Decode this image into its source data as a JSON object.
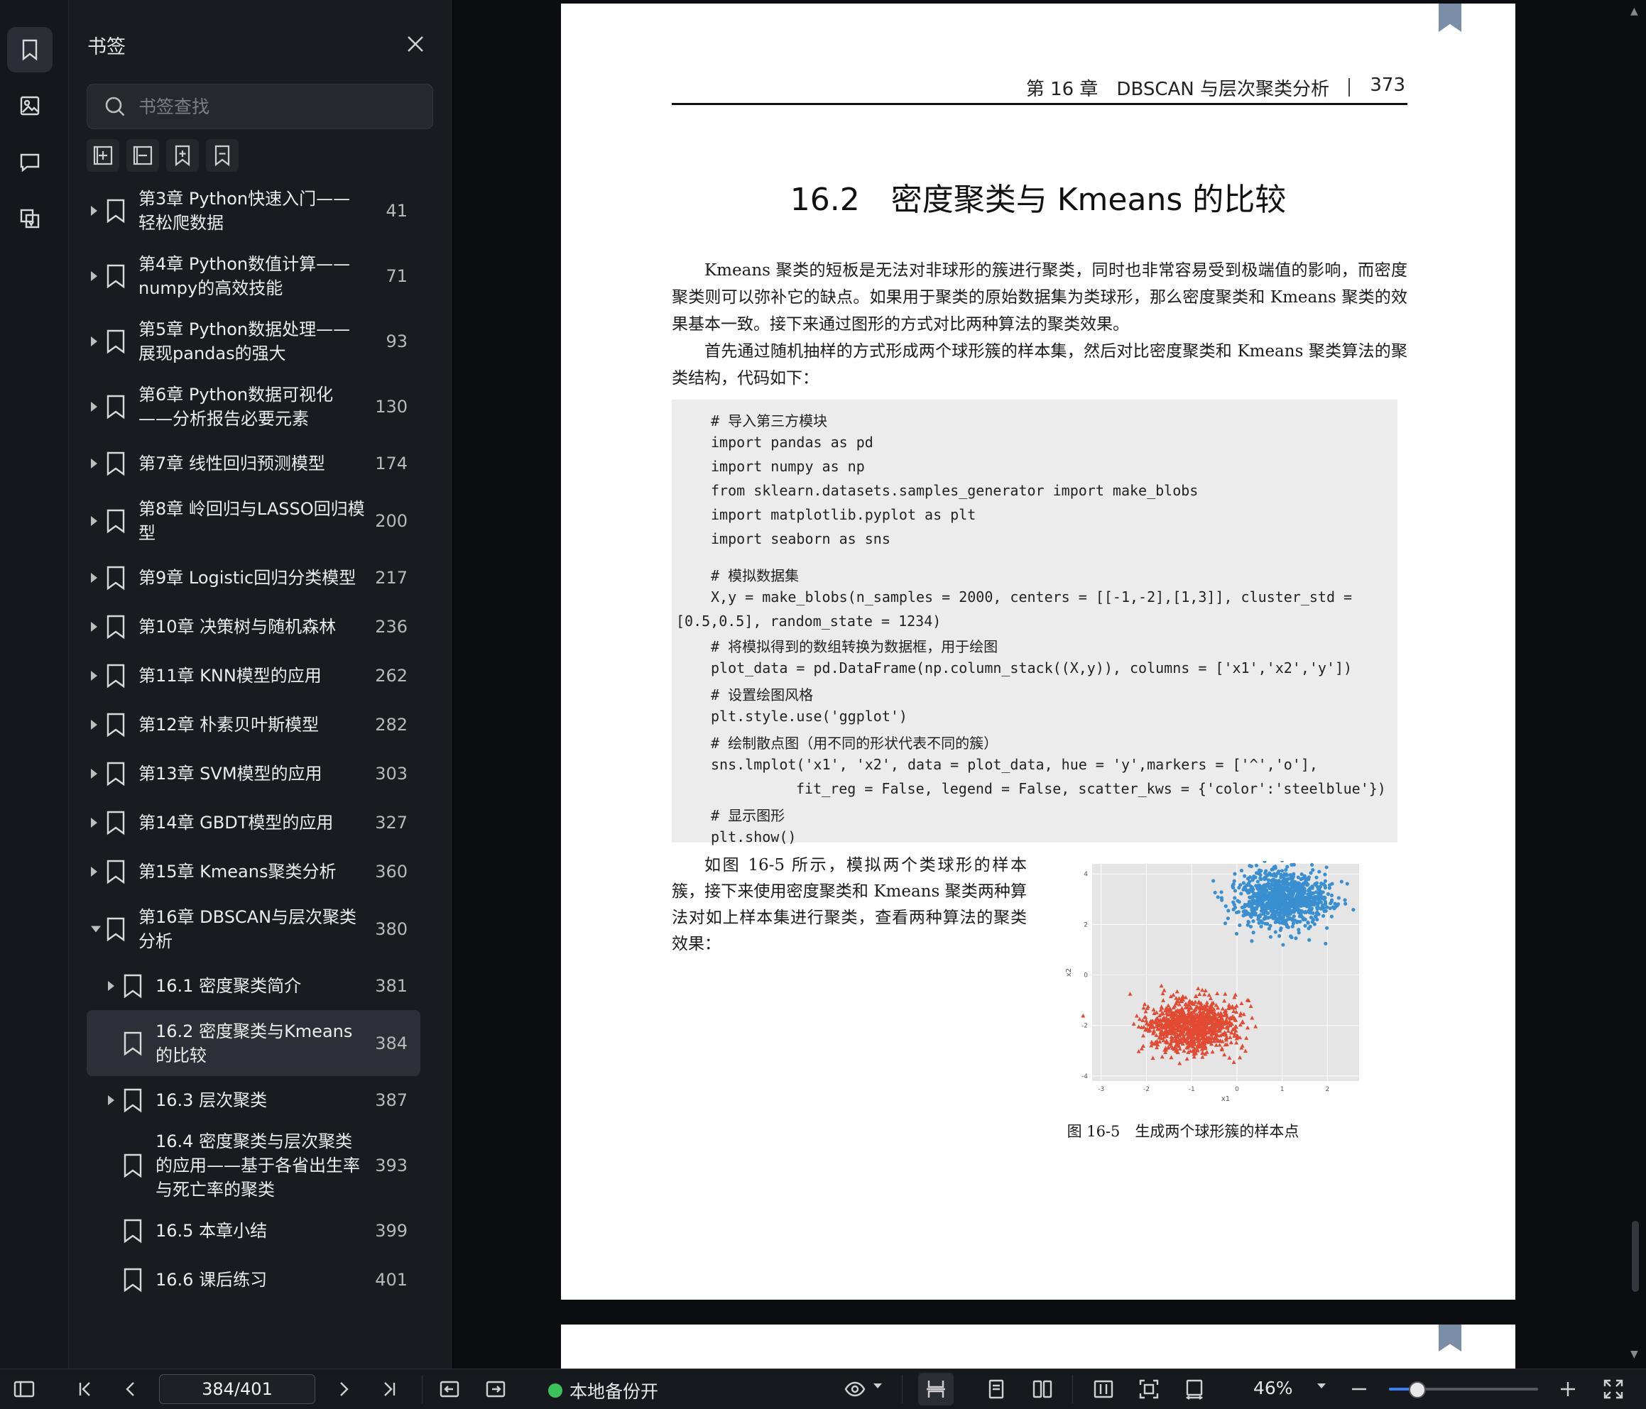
{
  "panel": {
    "title": "书签",
    "search_placeholder": "书签查找"
  },
  "toc": [
    {
      "label": "第3章 Python快速入门——轻松爬数据",
      "page": "41",
      "level": 0,
      "arrow": "right"
    },
    {
      "label": "第4章 Python数值计算——numpy的高效技能",
      "page": "71",
      "level": 0,
      "arrow": "right"
    },
    {
      "label": "第5章 Python数据处理——展现pandas的强大",
      "page": "93",
      "level": 0,
      "arrow": "right"
    },
    {
      "label": "第6章 Python数据可视化——分析报告必要元素",
      "page": "130",
      "level": 0,
      "arrow": "right"
    },
    {
      "label": "第7章 线性回归预测模型",
      "page": "174",
      "level": 0,
      "arrow": "right"
    },
    {
      "label": "第8章 岭回归与LASSO回归模型",
      "page": "200",
      "level": 0,
      "arrow": "right"
    },
    {
      "label": "第9章 Logistic回归分类模型",
      "page": "217",
      "level": 0,
      "arrow": "right"
    },
    {
      "label": "第10章 决策树与随机森林",
      "page": "236",
      "level": 0,
      "arrow": "right"
    },
    {
      "label": "第11章 KNN模型的应用",
      "page": "262",
      "level": 0,
      "arrow": "right"
    },
    {
      "label": "第12章 朴素贝叶斯模型",
      "page": "282",
      "level": 0,
      "arrow": "right"
    },
    {
      "label": "第13章 SVM模型的应用",
      "page": "303",
      "level": 0,
      "arrow": "right"
    },
    {
      "label": "第14章 GBDT模型的应用",
      "page": "327",
      "level": 0,
      "arrow": "right"
    },
    {
      "label": "第15章 Kmeans聚类分析",
      "page": "360",
      "level": 0,
      "arrow": "right"
    },
    {
      "label": "第16章 DBSCAN与层次聚类分析",
      "page": "380",
      "level": 0,
      "arrow": "down"
    },
    {
      "label": "16.1 密度聚类简介",
      "page": "381",
      "level": 1,
      "arrow": "right"
    },
    {
      "label": "16.2 密度聚类与Kmeans的比较",
      "page": "384",
      "level": 1,
      "arrow": "none",
      "selected": true
    },
    {
      "label": "16.3 层次聚类",
      "page": "387",
      "level": 1,
      "arrow": "right"
    },
    {
      "label": "16.4 密度聚类与层次聚类的应用——基于各省出生率与死亡率的聚类",
      "page": "393",
      "level": 1,
      "arrow": "none"
    },
    {
      "label": "16.5 本章小结",
      "page": "399",
      "level": 1,
      "arrow": "none"
    },
    {
      "label": "16.6 课后练习",
      "page": "401",
      "level": 1,
      "arrow": "none"
    }
  ],
  "document": {
    "running_head": "第 16 章　DBSCAN 与层次聚类分析",
    "page_number": "373",
    "section_title": "16.2　密度聚类与 Kmeans 的比较",
    "para1": "Kmeans 聚类的短板是无法对非球形的簇进行聚类，同时也非常容易受到极端值的影响，而密度聚类则可以弥补它的缺点。如果用于聚类的原始数据集为类球形，那么密度聚类和 Kmeans 聚类的效果基本一致。接下来通过图形的方式对比两种算法的聚类效果。",
    "para2": "首先通过随机抽样的方式形成两个球形簇的样本集，然后对比密度聚类和 Kmeans 聚类算法的聚类结构，代码如下：",
    "code_lines": [
      {
        "text": "# 导入第三方模块",
        "kind": "normal"
      },
      {
        "text": "import pandas as pd",
        "kind": "normal"
      },
      {
        "text": "import numpy as np",
        "kind": "normal"
      },
      {
        "text": "from sklearn.datasets.samples_generator import make_blobs",
        "kind": "normal"
      },
      {
        "text": "import matplotlib.pyplot as plt",
        "kind": "normal"
      },
      {
        "text": "import seaborn as sns",
        "kind": "normal"
      },
      {
        "text": "# 模拟数据集",
        "kind": "normal"
      },
      {
        "text": "X,y = make_blobs(n_samples = 2000, centers = [[-1,-2],[1,3]], cluster_std =",
        "kind": "normal"
      },
      {
        "text": "[0.5,0.5], random_state = 1234)",
        "kind": "cont"
      },
      {
        "text": "# 将模拟得到的数组转换为数据框，用于绘图",
        "kind": "normal"
      },
      {
        "text": "plot_data = pd.DataFrame(np.column_stack((X,y)), columns = ['x1','x2','y'])",
        "kind": "normal"
      },
      {
        "text": "# 设置绘图风格",
        "kind": "normal"
      },
      {
        "text": "plt.style.use('ggplot')",
        "kind": "normal"
      },
      {
        "text": "# 绘制散点图（用不同的形状代表不同的簇）",
        "kind": "normal"
      },
      {
        "text": "sns.lmplot('x1', 'x2', data = plot_data, hue = 'y',markers = ['^','o'],",
        "kind": "normal"
      },
      {
        "text": "fit_reg = False, legend = False, scatter_kws = {'color':'steelblue'})",
        "kind": "ind"
      },
      {
        "text": "# 显示图形",
        "kind": "normal"
      },
      {
        "text": "plt.show()",
        "kind": "normal"
      }
    ],
    "para3": "如图 16-5 所示，模拟两个类球形的样本簇，接下来使用密度聚类和 Kmeans 聚类两种算法对如上样本集进行聚类，查看两种算法的聚类效果：",
    "figure": {
      "caption": "图 16-5　生成两个球形簇的样本点",
      "xlabel": "x1",
      "ylabel": "x2",
      "x_ticks": [
        "-3",
        "-2",
        "-1",
        "0",
        "1",
        "2"
      ],
      "y_ticks": [
        "4",
        "2",
        "0",
        "-2",
        "-4"
      ],
      "xlim": [
        -3.2,
        2.7
      ],
      "ylim": [
        -4.2,
        4.4
      ],
      "plot_bg": "#e5e5e5",
      "clusters": [
        {
          "center": [
            1.0,
            3.0
          ],
          "std": 0.5,
          "color": "#3a8fd0",
          "marker": "circle"
        },
        {
          "center": [
            -1.0,
            -2.0
          ],
          "std": 0.5,
          "color": "#e24a33",
          "marker": "triangle"
        }
      ]
    }
  },
  "statusbar": {
    "page_indicator": "384/401",
    "backup_label": "本地备份开",
    "zoom": "46%",
    "zoom_fraction": 0.18
  },
  "colors": {
    "accent": "#3b82f6",
    "backup_dot": "#3cc25a"
  }
}
